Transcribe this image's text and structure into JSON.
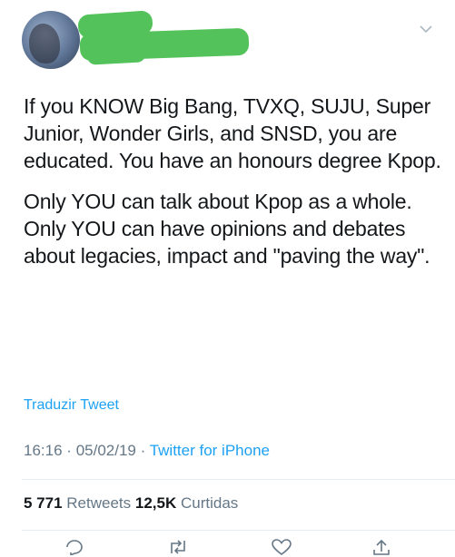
{
  "tweet": {
    "paragraph1": "If you KNOW Big Bang, TVXQ, SUJU, Super Junior, Wonder Girls, and SNSD, you are educated. You have an honours degree Kpop.",
    "paragraph2": "Only YOU can talk about Kpop as a whole. Only YOU can have opinions and debates about legacies, impact and \"paving the way\".",
    "translate_label": "Traduzir Tweet",
    "time": "16:16",
    "date": "05/02/19",
    "separator": "·",
    "source": "Twitter for iPhone"
  },
  "stats": {
    "retweets_count": "5 771",
    "retweets_label": "Retweets",
    "likes_count": "12,5K",
    "likes_label": "Curtidas"
  },
  "colors": {
    "link": "#1da1f2",
    "muted": "#657786",
    "redaction": "#54c25a"
  },
  "icons": [
    "chevron-down-icon",
    "reply-icon",
    "retweet-icon",
    "like-icon",
    "share-icon"
  ]
}
